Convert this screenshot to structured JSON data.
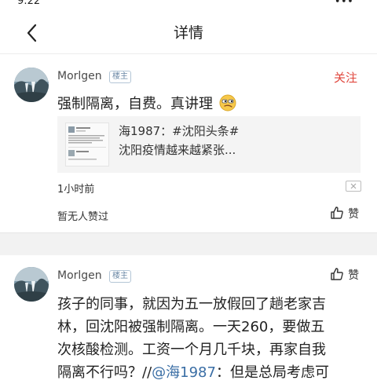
{
  "status_bar": {
    "left": "9:22",
    "right": "∙∙∙"
  },
  "nav": {
    "title": "详情"
  },
  "post": {
    "username": "Morlgen",
    "badge": "楼主",
    "follow_label": "关注",
    "text": "强制隔离，自费。真讲理",
    "emoji": "smirk-emoji",
    "quote": {
      "title": "海1987：#沈阳头条#",
      "subtitle": "沈阳疫情越来越紧张..."
    },
    "time": "1小时前",
    "no_likes_text": "暂无人赞过",
    "like_label": "赞"
  },
  "reply": {
    "username": "Morlgen",
    "badge": "楼主",
    "like_label": "赞",
    "text_lines": [
      "孩子的同事，就因为五一放假回了趟老家吉",
      "林，回沈阳被强制隔离。一天260，要做五",
      "次核酸检测。工资一个月几千块，再家自我"
    ],
    "last_line_prefix": "隔离不行吗？//",
    "last_line_mention": "@海1987",
    "last_line_suffix": "：但是总局考虑可"
  },
  "colors": {
    "accent_red": "#e0463c",
    "link_blue": "#3a6ea5",
    "divider": "#f2f2f2"
  }
}
